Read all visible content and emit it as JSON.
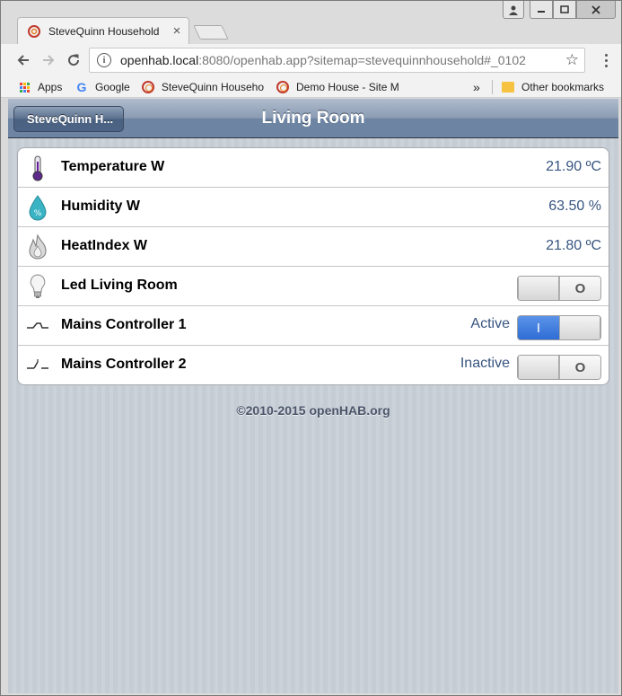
{
  "browser": {
    "tab": {
      "title": "SteveQuinn Household",
      "close": "×"
    },
    "address": {
      "host": "openhab.local",
      "rest": ":8080/openhab.app?sitemap=stevequinnhousehold#_0102"
    },
    "bookmarks": [
      {
        "label": "Apps",
        "icon": "apps-grid-icon"
      },
      {
        "label": "Google",
        "icon": "google-icon"
      },
      {
        "label": "SteveQuinn Househo",
        "icon": "openhab-icon"
      },
      {
        "label": "Demo House - Site M",
        "icon": "openhab-icon"
      }
    ],
    "overflow": "»",
    "other_bookmarks": "Other bookmarks"
  },
  "header": {
    "back_label": "SteveQuinn H...",
    "title": "Living Room"
  },
  "items": [
    {
      "label": "Temperature W",
      "value": "21.90 ºC",
      "icon": "thermometer-icon"
    },
    {
      "label": "Humidity W",
      "value": "63.50 %",
      "icon": "humidity-drop-icon"
    },
    {
      "label": "HeatIndex W",
      "value": "21.80 ºC",
      "icon": "flame-icon"
    },
    {
      "label": "Led Living Room",
      "icon": "light-bulb-icon",
      "switch": {
        "state": "off",
        "off_text": "O"
      }
    },
    {
      "label": "Mains Controller 1",
      "status": "Active",
      "icon": "switch-closed-icon",
      "switch": {
        "state": "on",
        "on_text": "I"
      }
    },
    {
      "label": "Mains Controller 2",
      "status": "Inactive",
      "icon": "switch-open-icon",
      "switch": {
        "state": "off",
        "off_text": "O"
      }
    }
  ],
  "footer": "©2010-2015 openHAB.org",
  "colors": {
    "value_text": "#385580",
    "switch_on": "#2f6dd5",
    "header": "#6d84a2"
  }
}
